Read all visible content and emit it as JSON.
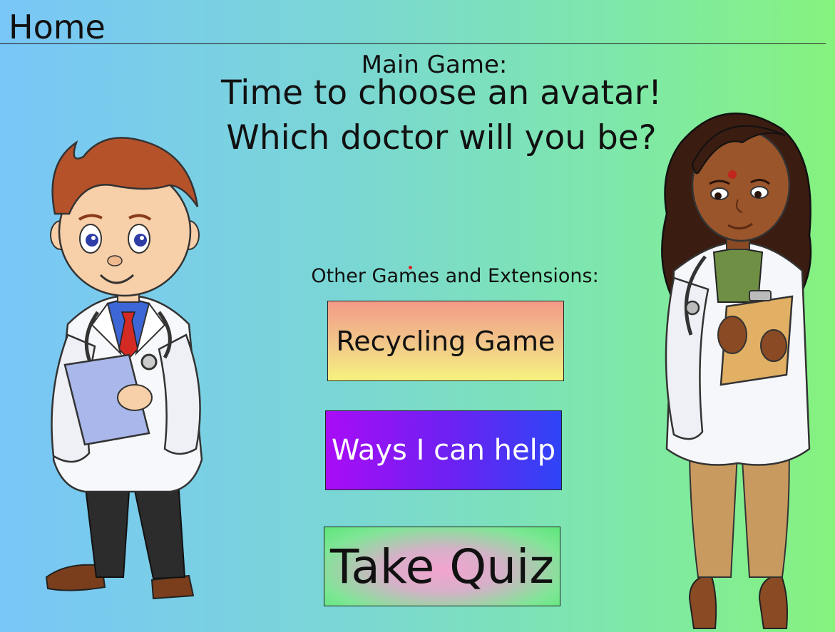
{
  "header": {
    "title": "Home"
  },
  "main": {
    "section_label": "Main Game:",
    "headline_line1": "Time to choose an avatar!",
    "headline_line2": "Which doctor will you be?"
  },
  "extensions": {
    "section_label": "Other Games and Extensions:",
    "buttons": [
      {
        "label": "Recycling Game"
      },
      {
        "label": "Ways I can help"
      },
      {
        "label": "Take Quiz"
      }
    ]
  },
  "avatars": [
    {
      "icon": "male-doctor-avatar"
    },
    {
      "icon": "female-doctor-avatar"
    }
  ],
  "colors": {
    "background_left": "#79c6f8",
    "background_right": "#86f27e",
    "recycling_top": "#f39a86",
    "recycling_bottom": "#f6f37e",
    "help_left": "#a90cf6",
    "help_right": "#2f45f7",
    "quiz_center": "#f3a4d0",
    "quiz_edge": "#5de67a"
  }
}
